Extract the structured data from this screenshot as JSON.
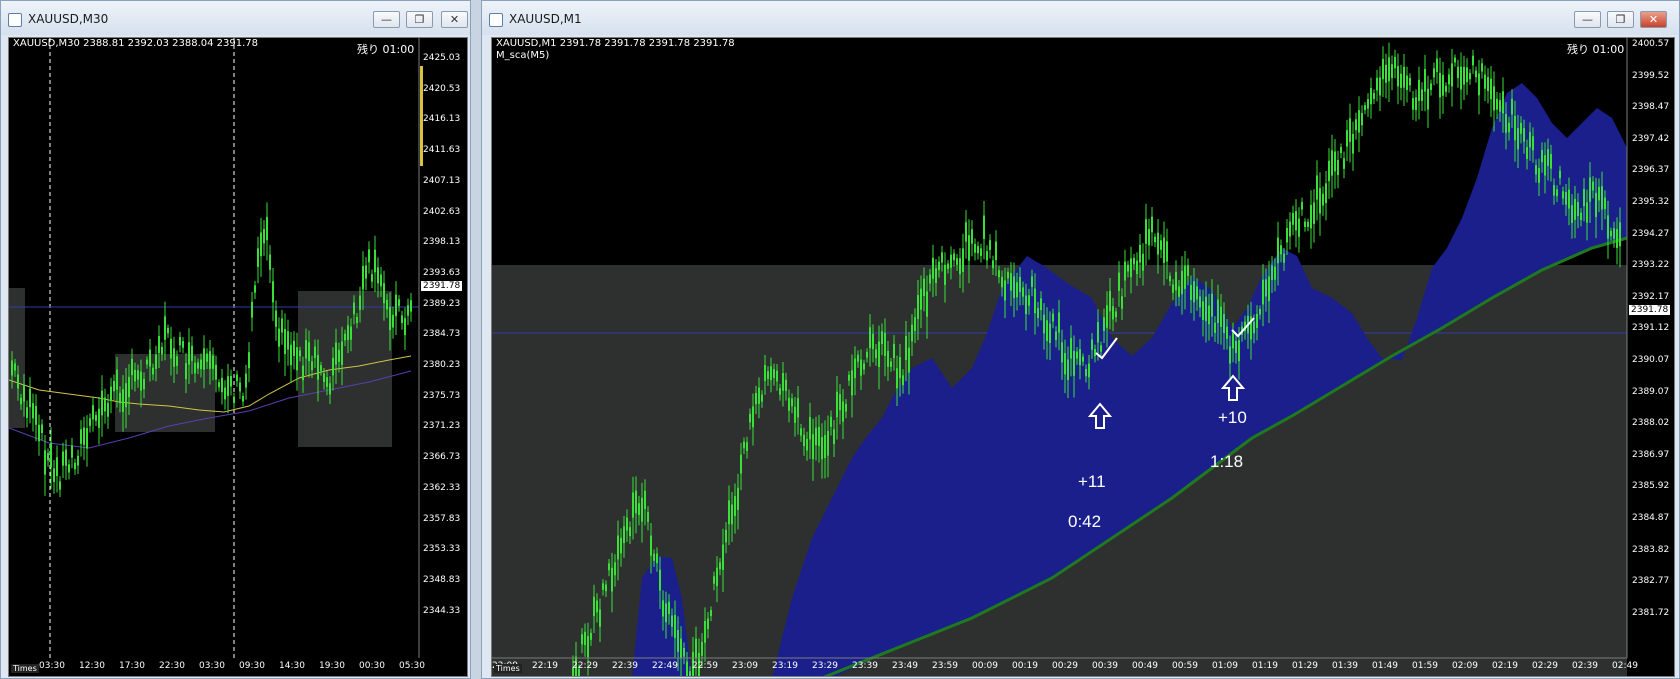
{
  "left_window": {
    "title": "XAUUSD,M30",
    "info": "XAUUSD,M30  2388.81 2392.03 2388.04 2391.78",
    "remaining": "残り 01:00",
    "current_price": "2391.78",
    "price_labels": [
      "2425.03",
      "2420.53",
      "2416.13",
      "2411.63",
      "2407.13",
      "2402.63",
      "2398.13",
      "2393.63",
      "2389.23",
      "2384.73",
      "2380.23",
      "2375.73",
      "2371.23",
      "2366.73",
      "2362.33",
      "2357.83",
      "2353.33",
      "2348.83",
      "2344.33"
    ],
    "time_labels": [
      "03:30",
      "12:30",
      "17:30",
      "22:30",
      "03:30",
      "09:30",
      "14:30",
      "19:30",
      "00:30",
      "05:30"
    ],
    "times_box": "Times"
  },
  "right_window": {
    "title": "XAUUSD,M1",
    "info": "XAUUSD,M1  2391.78 2391.78 2391.78 2391.78",
    "indicator": "M_sca(M5)",
    "remaining": "残り 01:00",
    "current_price": "2391.78",
    "price_labels": [
      "2400.57",
      "2399.52",
      "2398.47",
      "2397.42",
      "2396.37",
      "2395.32",
      "2394.27",
      "2393.22",
      "2392.17",
      "2391.12",
      "2390.07",
      "2389.07",
      "2388.02",
      "2386.97",
      "2385.92",
      "2384.87",
      "2383.82",
      "2382.77",
      "2381.72"
    ],
    "time_labels": [
      "22:09",
      "22:19",
      "22:29",
      "22:39",
      "22:49",
      "22:59",
      "23:09",
      "23:19",
      "23:29",
      "23:39",
      "23:49",
      "23:59",
      "00:09",
      "00:19",
      "00:29",
      "00:39",
      "00:49",
      "00:59",
      "01:09",
      "01:19",
      "01:29",
      "01:39",
      "01:49",
      "01:59",
      "02:09",
      "02:19",
      "02:29",
      "02:39",
      "02:49"
    ],
    "times_box": "Times",
    "annotations": {
      "a1_pips": "+11",
      "a1_time": "0:42",
      "a2_pips": "+10",
      "a2_time": "1:18"
    }
  },
  "window_buttons": {
    "minimize": "—",
    "restore": "❐",
    "close": "✕"
  },
  "colors": {
    "candle": "#38e038",
    "ma_fill": "#1b1f8c",
    "ma_line": "#1f7a1f",
    "zone": "#2d302e",
    "price_line": "#2f3ba8"
  }
}
